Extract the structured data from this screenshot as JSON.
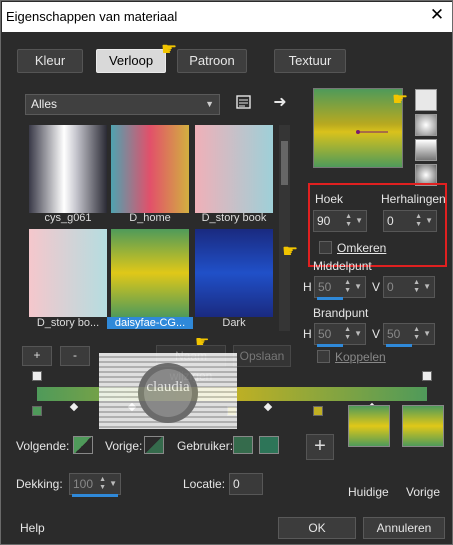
{
  "window": {
    "title": "Eigenschappen van materiaal",
    "close_glyph": "✕"
  },
  "tabs": [
    {
      "label": "Kleur",
      "active": false
    },
    {
      "label": "Verloop",
      "active": true
    },
    {
      "label": "Patroon",
      "active": false
    },
    {
      "label": "Textuur",
      "active": false
    }
  ],
  "library": {
    "filter": "Alles",
    "items": [
      {
        "name": "cys_g061",
        "colors": [
          "#3a3a48",
          "#ffffff",
          "#2a2a34"
        ]
      },
      {
        "name": "D_home",
        "colors": [
          "#4fa3b0",
          "#e2506a",
          "#d2b040"
        ]
      },
      {
        "name": "D_story book",
        "colors": [
          "#f0b0b8",
          "#9ed0d8"
        ]
      },
      {
        "name": "D_story bo...",
        "colors": [
          "#f5c7cc",
          "#b5dde0"
        ]
      },
      {
        "name": "daisyfae-CG...",
        "colors": [
          "#4f9a5a",
          "#e0c818",
          "#4f9a5a"
        ],
        "selected": true
      },
      {
        "name": "Dark",
        "colors": [
          "#1a2a80",
          "#2050c8",
          "#1a2a80"
        ]
      }
    ]
  },
  "buttons": {
    "add": "+",
    "remove": "-",
    "rename": "Naam wijzigen",
    "save": "Opslaan",
    "plus_big": "+",
    "ok": "OK",
    "cancel": "Annuleren",
    "help": "Help"
  },
  "settings": {
    "hoek_label": "Hoek",
    "hoek_value": "90",
    "herhalingen_label": "Herhalingen",
    "herhalingen_value": "0",
    "omkeren_label": "Omkeren",
    "middelpunt_label": "Middelpunt",
    "brandpunt_label": "Brandpunt",
    "h_label": "H",
    "v_label": "V",
    "mid_h": "50",
    "mid_v": "0",
    "brand_h": "50",
    "brand_v": "50",
    "koppelen_label": "Koppelen"
  },
  "bottom": {
    "volgende_label": "Volgende:",
    "vorige_label": "Vorige:",
    "gebruiker_label": "Gebruiker:",
    "dekking_label": "Dekking:",
    "dekking_value": "100",
    "locatie_label": "Locatie:",
    "locatie_value": "0",
    "huidige_label": "Huidige",
    "vorige_swatch_label": "Vorige",
    "user_colors": [
      "#356b4c",
      "#2d7558"
    ]
  },
  "watermark_text": "claudia",
  "colors": {
    "accent": "#2f89d9",
    "highlight": "#e02020",
    "gradient_green": "#4f9a5a",
    "gradient_yellow": "#d9c21c"
  }
}
